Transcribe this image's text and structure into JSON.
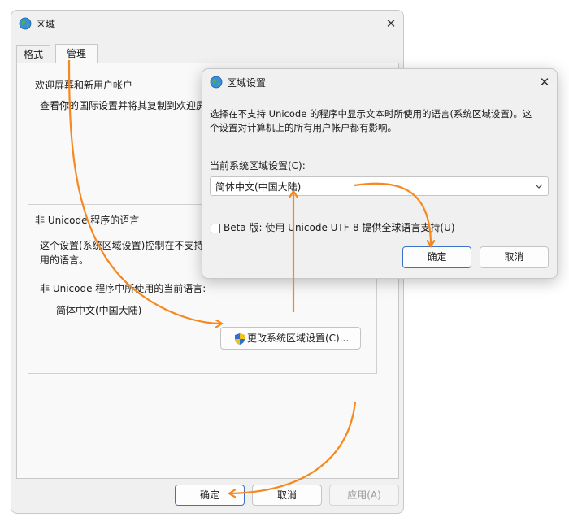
{
  "main_window": {
    "title": "区域",
    "tabs": [
      {
        "label": "格式",
        "active": false
      },
      {
        "label": "管理",
        "active": true
      }
    ],
    "welcome_group": {
      "title": "欢迎屏幕和新用户帐户",
      "description": "查看你的国际设置并将其复制到欢迎屏"
    },
    "nonunicode_group": {
      "title": "非 Unicode 程序的语言",
      "description_line1": "这个设置(系统区域设置)控制在不支持",
      "description_line2": "用的语言。",
      "current_label": "非 Unicode 程序中所使用的当前语言:",
      "current_value": "简体中文(中国大陆)",
      "change_button": "更改系统区域设置(C)..."
    },
    "buttons": {
      "ok": "确定",
      "cancel": "取消",
      "apply": "应用(A)"
    }
  },
  "sub_window": {
    "title": "区域设置",
    "description_line1": "选择在不支持 Unicode 的程序中显示文本时所使用的语言(系统区域设置)。这",
    "description_line2": "个设置对计算机上的所有用户帐户都有影响。",
    "locale_label": "当前系统区域设置(C):",
    "locale_value": "简体中文(中国大陆)",
    "beta_checkbox_label": "Beta 版: 使用 Unicode UTF-8 提供全球语言支持(U)",
    "beta_checked": false,
    "buttons": {
      "ok": "确定",
      "cancel": "取消"
    }
  },
  "colors": {
    "annotation_arrow": "#f5891f",
    "primary_button_border": "#3b72c9",
    "window_bg": "#f0f0f0"
  },
  "icons": {
    "window_icon": "globe-icon",
    "change_button_icon": "shield-icon",
    "close_icon": "close-icon"
  }
}
